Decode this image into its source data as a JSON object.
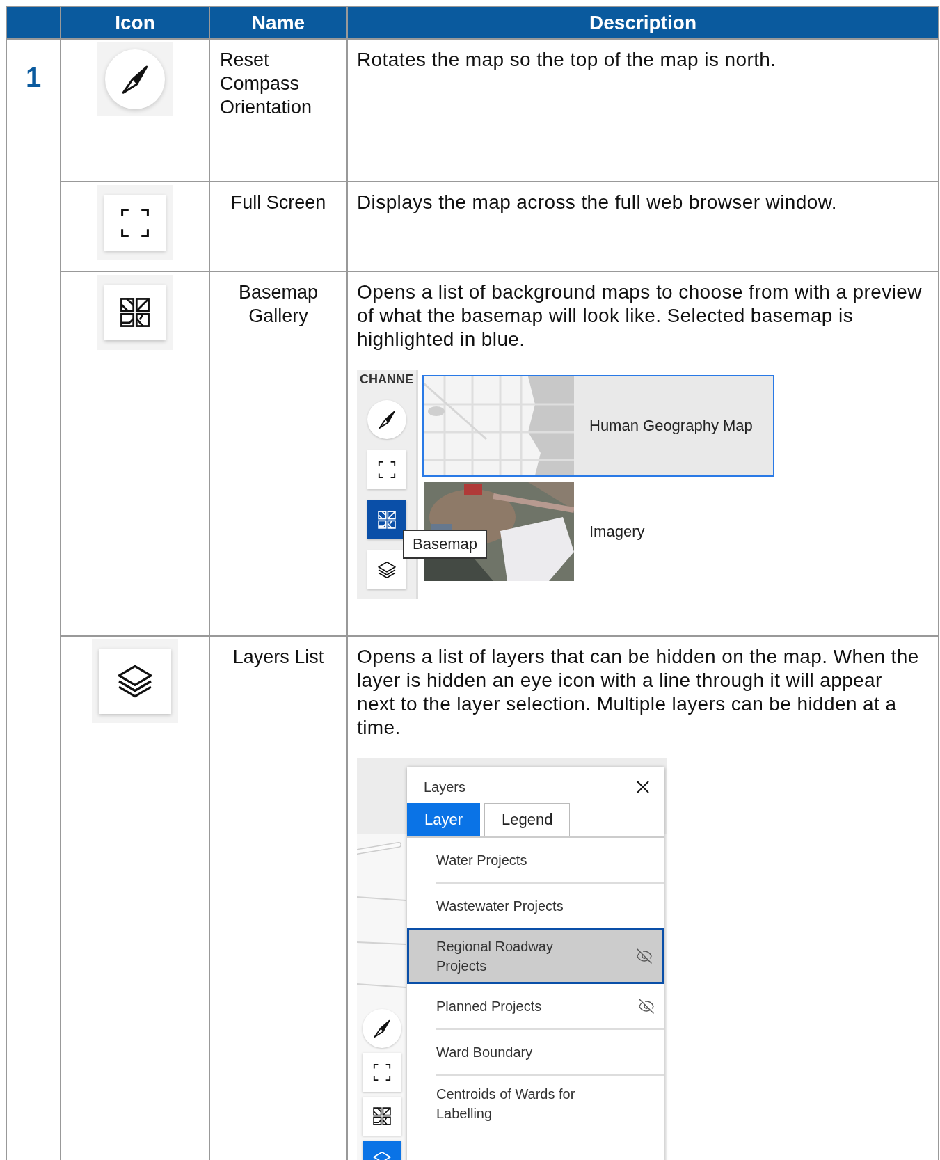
{
  "table": {
    "columns": [
      {
        "label": "Icon"
      },
      {
        "label": "Name"
      },
      {
        "label": "Description"
      }
    ],
    "number": "1",
    "rows": [
      {
        "kind": "compass",
        "name": "Reset Compass Orientation",
        "description": "Rotates the map so the top of the map is north."
      },
      {
        "kind": "fullscreen",
        "name": "Full Screen",
        "description": "Displays the map across the full web browser window."
      },
      {
        "kind": "basemap",
        "name": "Basemap Gallery",
        "description": "Opens a list of background maps to choose from with a preview of what the basemap will look like. Selected basemap is highlighted in blue.",
        "preview": {
          "kind": "basemap",
          "map_label": "CHANNE",
          "tooltip": "Basemap",
          "tools": [
            {
              "kind": "compass",
              "selected": false
            },
            {
              "kind": "fullscreen",
              "selected": false
            },
            {
              "kind": "basemap",
              "selected": true
            },
            {
              "kind": "layers",
              "selected": false
            }
          ],
          "basemaps": [
            {
              "name": "Human Geography Map",
              "kind": "map",
              "selected": true
            },
            {
              "name": "Imagery",
              "kind": "imagery",
              "selected": false
            }
          ]
        }
      },
      {
        "kind": "layers",
        "name": "Layers List",
        "description": "Opens a list of layers that can be hidden on the map. When the layer is hidden an eye icon with a line through it will appear next to the layer selection. Multiple layers can be hidden at a time.",
        "preview": {
          "kind": "layers",
          "panel_title": "Layers",
          "tools": [
            {
              "kind": "compass",
              "selected": false
            },
            {
              "kind": "fullscreen",
              "selected": false
            },
            {
              "kind": "basemap",
              "selected": false
            },
            {
              "kind": "layers",
              "selected": true
            }
          ],
          "tabs": [
            {
              "label": "Layer",
              "selected": true
            },
            {
              "label": "Legend",
              "selected": false
            }
          ],
          "layers": [
            {
              "name": "Water Projects",
              "selected": false,
              "hidden": false
            },
            {
              "name": "Wastewater Projects",
              "selected": false,
              "hidden": false
            },
            {
              "name": "Regional Roadway Projects",
              "selected": true,
              "hidden": true
            },
            {
              "name": "Planned Projects",
              "selected": false,
              "hidden": true
            },
            {
              "name": "Ward Boundary",
              "selected": false,
              "hidden": false
            },
            {
              "name": "Centroids of Wards for Labelling",
              "selected": false,
              "hidden": false
            }
          ]
        }
      }
    ]
  }
}
